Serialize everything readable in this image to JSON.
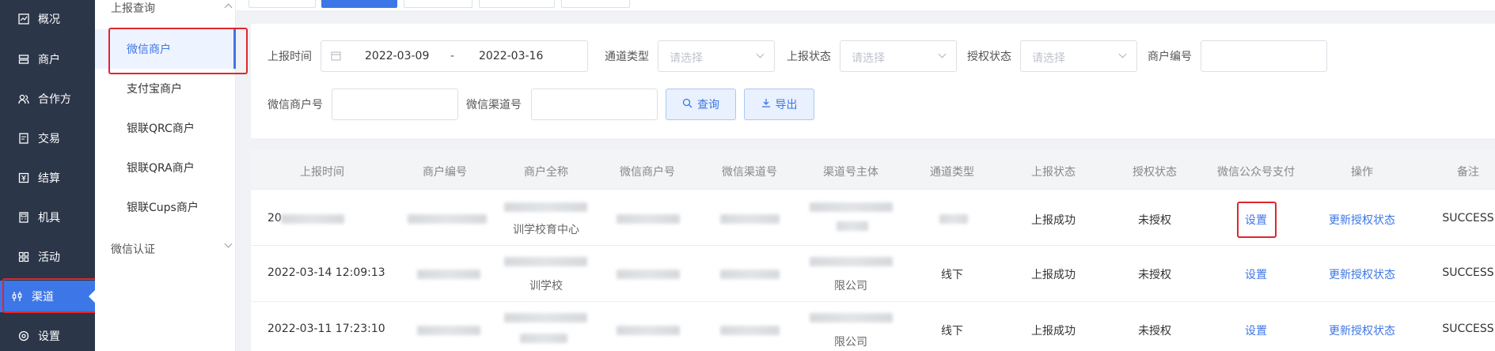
{
  "nav": {
    "items": [
      {
        "label": "概况",
        "icon": "dashboard-icon"
      },
      {
        "label": "商户",
        "icon": "merchant-icon"
      },
      {
        "label": "合作方",
        "icon": "partner-icon"
      },
      {
        "label": "交易",
        "icon": "transaction-icon"
      },
      {
        "label": "结算",
        "icon": "settlement-icon"
      },
      {
        "label": "机具",
        "icon": "device-icon"
      },
      {
        "label": "活动",
        "icon": "activity-icon"
      },
      {
        "label": "渠道",
        "icon": "channel-icon",
        "active": true
      },
      {
        "label": "设置",
        "icon": "settings-icon"
      }
    ]
  },
  "submenu": {
    "group1": "上报查询",
    "items": [
      "微信商户",
      "支付宝商户",
      "银联QRC商户",
      "银联QRA商户",
      "银联Cups商户"
    ],
    "group2": "微信认证"
  },
  "filters": {
    "report_time_label": "上报时间",
    "date_start": "2022-03-09",
    "date_sep": "-",
    "date_end": "2022-03-16",
    "channel_type_label": "通道类型",
    "report_status_label": "上报状态",
    "auth_status_label": "授权状态",
    "merchant_no_label": "商户编号",
    "wx_merchant_no_label": "微信商户号",
    "wx_channel_no_label": "微信渠道号",
    "select_placeholder": "请选择",
    "query_button": "查询",
    "export_button": "导出"
  },
  "table": {
    "columns": [
      "上报时间",
      "商户编号",
      "商户全称",
      "微信商户号",
      "微信渠道号",
      "渠道号主体",
      "通道类型",
      "上报状态",
      "授权状态",
      "微信公众号支付",
      "操作",
      "备注"
    ],
    "rows": [
      {
        "report_time": "20",
        "merchant_name_partial": "训学校育中心",
        "channel_subject_partial": "",
        "channel_type": "",
        "report_status": "上报成功",
        "auth_status": "未授权",
        "wx_pay": "设置",
        "action": "更新授权状态",
        "remark": "SUCCESS"
      },
      {
        "report_time": "2022-03-14 12:09:13",
        "merchant_name_partial": "训学校",
        "channel_subject_partial": "限公司",
        "channel_type": "线下",
        "report_status": "上报成功",
        "auth_status": "未授权",
        "wx_pay": "设置",
        "action": "更新授权状态",
        "remark": "SUCCESS"
      },
      {
        "report_time": "2022-03-11 17:23:10",
        "merchant_name_partial": "",
        "channel_subject_partial": "限公司",
        "channel_type": "线下",
        "report_status": "上报成功",
        "auth_status": "未授权",
        "wx_pay": "设置",
        "action": "更新授权状态",
        "remark": "SUCCESS"
      }
    ]
  },
  "colors": {
    "nav_bg": "#2b3649",
    "accent": "#3d76e6",
    "highlight_red": "#e0262b"
  }
}
